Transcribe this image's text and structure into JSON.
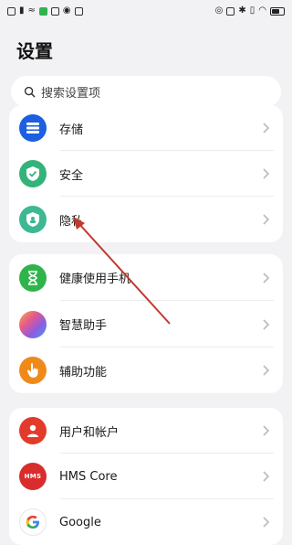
{
  "page": {
    "title": "设置"
  },
  "search": {
    "placeholder": "搜索设置项"
  },
  "groups": [
    {
      "items": [
        {
          "label": "存储",
          "icon": "storage-icon"
        },
        {
          "label": "安全",
          "icon": "shield-check-icon"
        },
        {
          "label": "隐私",
          "icon": "privacy-shield-icon"
        }
      ]
    },
    {
      "items": [
        {
          "label": "健康使用手机",
          "icon": "hourglass-icon"
        },
        {
          "label": "智慧助手",
          "icon": "assistant-orb-icon"
        },
        {
          "label": "辅助功能",
          "icon": "hand-touch-icon"
        }
      ]
    },
    {
      "items": [
        {
          "label": "用户和帐户",
          "icon": "user-icon"
        },
        {
          "label": "HMS Core",
          "icon": "hms-core-icon",
          "icon_text": "HMS"
        },
        {
          "label": "Google",
          "icon": "google-icon",
          "icon_text": "G"
        }
      ]
    }
  ],
  "colors": {
    "background": "#f2f2f4",
    "annotation_arrow": "#c0392b",
    "storage": "#1c5fe0",
    "security": "#33b37a",
    "privacy": "#3db892",
    "health": "#2fb44b",
    "accessibility": "#ef8a1a",
    "account": "#e23b2b",
    "hms": "#d92d2d"
  }
}
